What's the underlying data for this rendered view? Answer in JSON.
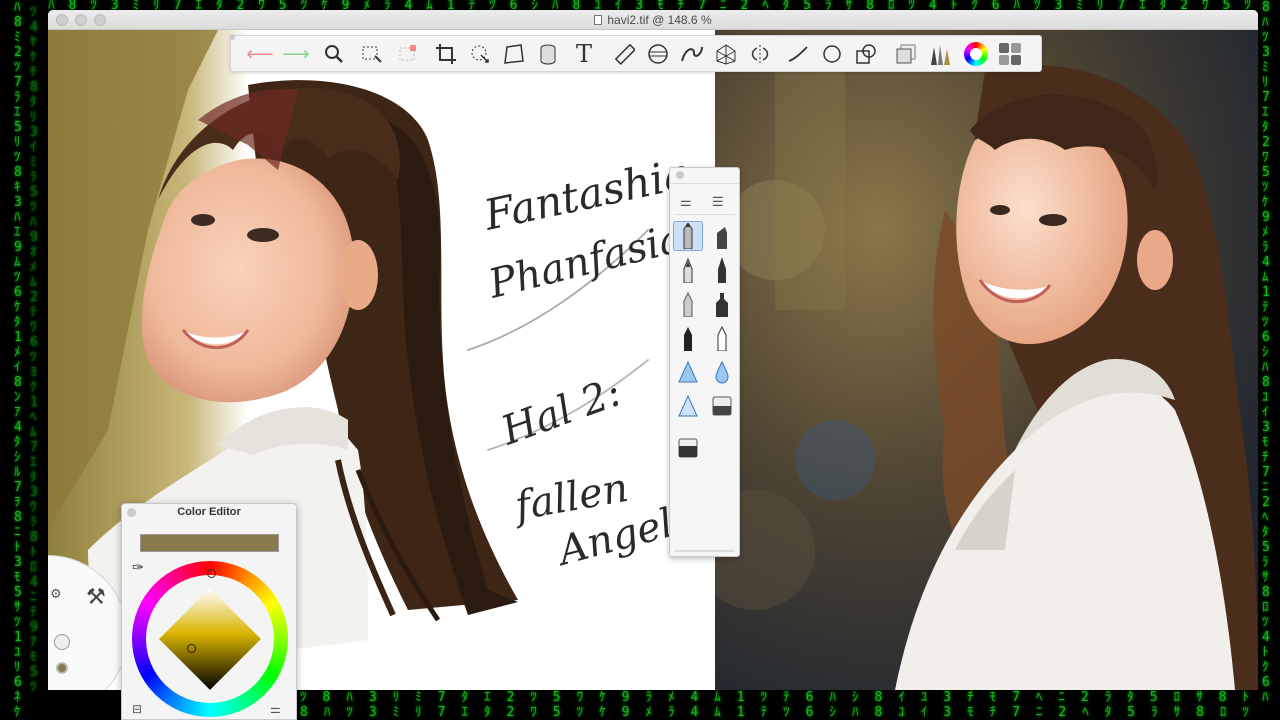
{
  "window": {
    "title": "havi2.tif @ 148.6 %"
  },
  "toolbar": {
    "tools": [
      {
        "name": "undo-icon",
        "glyph": "⟵"
      },
      {
        "name": "redo-icon",
        "glyph": "⟶"
      },
      {
        "name": "zoom-icon",
        "glyph": "🔍"
      },
      {
        "name": "selection-icon",
        "glyph": "⬚"
      },
      {
        "name": "clear-selection-icon",
        "glyph": "⬚"
      },
      {
        "name": "crop-icon",
        "glyph": "⌗"
      },
      {
        "name": "transform-icon",
        "glyph": "⊕"
      },
      {
        "name": "distort-icon",
        "glyph": "▱"
      },
      {
        "name": "fill-icon",
        "glyph": "▮"
      },
      {
        "name": "text-icon",
        "glyph": "T"
      },
      {
        "name": "ruler-icon",
        "glyph": "📏"
      },
      {
        "name": "ellipse-guide-icon",
        "glyph": "◎"
      },
      {
        "name": "french-curve-icon",
        "glyph": "∽"
      },
      {
        "name": "perspective-icon",
        "glyph": "▦"
      },
      {
        "name": "symmetry-icon",
        "glyph": "⋮"
      },
      {
        "name": "stroke-icon",
        "glyph": "╱"
      },
      {
        "name": "ellipse-icon",
        "glyph": "◯"
      },
      {
        "name": "shape-icon",
        "glyph": "◪"
      },
      {
        "name": "layers-icon",
        "glyph": "❐"
      },
      {
        "name": "brush-library-icon",
        "glyph": "✎"
      },
      {
        "name": "color-wheel-icon",
        "glyph": "●"
      },
      {
        "name": "swatches-icon",
        "glyph": "▦"
      }
    ]
  },
  "color_editor": {
    "title": "Color Editor",
    "current_color": "#877a4c"
  },
  "handwriting": {
    "line1": "Fantashia",
    "line2": "Phanfasia",
    "line3": "Hal 2:",
    "line4": "fallen",
    "line5": "Angel"
  },
  "colors": {
    "matrix_green": "#1fd62a",
    "selected_tool": "#cde0f7"
  }
}
